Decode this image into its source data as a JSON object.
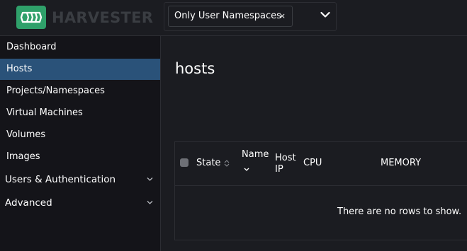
{
  "app": {
    "brand": "HARVESTER"
  },
  "namespace_filter": {
    "selected": "Only User Namespaces",
    "remove": "×"
  },
  "sidebar": {
    "items": [
      {
        "label": "Dashboard"
      },
      {
        "label": "Hosts",
        "active": true
      },
      {
        "label": "Projects/Namespaces"
      },
      {
        "label": "Virtual Machines"
      },
      {
        "label": "Volumes"
      },
      {
        "label": "Images"
      }
    ],
    "groups": [
      {
        "label": "Users & Authentication"
      },
      {
        "label": "Advanced"
      }
    ]
  },
  "main": {
    "title": "hosts",
    "table": {
      "columns": [
        {
          "label": "State"
        },
        {
          "label": "Name"
        },
        {
          "label": "Host IP"
        },
        {
          "label": "CPU"
        },
        {
          "label": "MEMORY"
        }
      ],
      "empty_text": "There are no rows to show."
    }
  },
  "colors": {
    "active": "#2a5279",
    "brand": "#2fa06a"
  }
}
